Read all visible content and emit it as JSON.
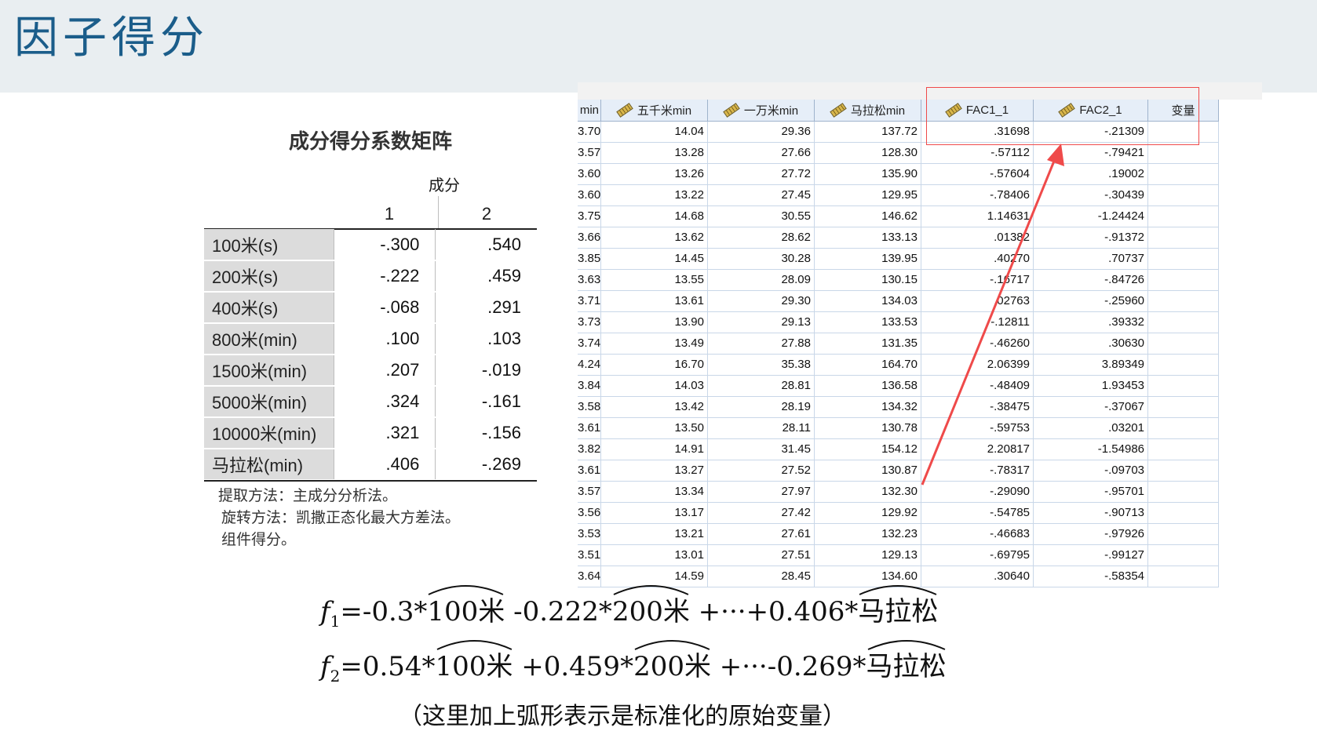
{
  "header": {
    "title": "因子得分"
  },
  "component_score": {
    "title": "成分得分系数矩阵",
    "group_label": "成分",
    "columns": [
      "1",
      "2"
    ],
    "rows": [
      {
        "label": "100米(s)",
        "c1": "-.300",
        "c2": ".540"
      },
      {
        "label": "200米(s)",
        "c1": "-.222",
        "c2": ".459"
      },
      {
        "label": "400米(s)",
        "c1": "-.068",
        "c2": ".291"
      },
      {
        "label": "800米(min)",
        "c1": ".100",
        "c2": ".103"
      },
      {
        "label": "1500米(min)",
        "c1": ".207",
        "c2": "-.019"
      },
      {
        "label": "5000米(min)",
        "c1": ".324",
        "c2": "-.161"
      },
      {
        "label": "10000米(min)",
        "c1": ".321",
        "c2": "-.156"
      },
      {
        "label": "马拉松(min)",
        "c1": ".406",
        "c2": "-.269"
      }
    ],
    "notes": [
      "提取方法：主成分分析法。",
      "旋转方法：凯撒正态化最大方差法。",
      "组件得分。"
    ]
  },
  "grid": {
    "headers": [
      "min",
      "五千米min",
      "一万米min",
      "马拉松min",
      "FAC1_1",
      "FAC2_1",
      "变量"
    ],
    "rows": [
      [
        "3.70",
        "14.04",
        "29.36",
        "137.72",
        ".31698",
        "-.21309"
      ],
      [
        "3.57",
        "13.28",
        "27.66",
        "128.30",
        "-.57112",
        "-.79421"
      ],
      [
        "3.60",
        "13.26",
        "27.72",
        "135.90",
        "-.57604",
        ".19002"
      ],
      [
        "3.60",
        "13.22",
        "27.45",
        "129.95",
        "-.78406",
        "-.30439"
      ],
      [
        "3.75",
        "14.68",
        "30.55",
        "146.62",
        "1.14631",
        "-1.24424"
      ],
      [
        "3.66",
        "13.62",
        "28.62",
        "133.13",
        ".01382",
        "-.91372"
      ],
      [
        "3.85",
        "14.45",
        "30.28",
        "139.95",
        ".40270",
        ".70737"
      ],
      [
        "3.63",
        "13.55",
        "28.09",
        "130.15",
        "-.16717",
        "-.84726"
      ],
      [
        "3.71",
        "13.61",
        "29.30",
        "134.03",
        ".02763",
        "-.25960"
      ],
      [
        "3.73",
        "13.90",
        "29.13",
        "133.53",
        "-.12811",
        ".39332"
      ],
      [
        "3.74",
        "13.49",
        "27.88",
        "131.35",
        "-.46260",
        ".30630"
      ],
      [
        "4.24",
        "16.70",
        "35.38",
        "164.70",
        "2.06399",
        "3.89349"
      ],
      [
        "3.84",
        "14.03",
        "28.81",
        "136.58",
        "-.48409",
        "1.93453"
      ],
      [
        "3.58",
        "13.42",
        "28.19",
        "134.32",
        "-.38475",
        "-.37067"
      ],
      [
        "3.61",
        "13.50",
        "28.11",
        "130.78",
        "-.59753",
        ".03201"
      ],
      [
        "3.82",
        "14.91",
        "31.45",
        "154.12",
        "2.20817",
        "-1.54986"
      ],
      [
        "3.61",
        "13.27",
        "27.52",
        "130.87",
        "-.78317",
        "-.09703"
      ],
      [
        "3.57",
        "13.34",
        "27.97",
        "132.30",
        "-.29090",
        "-.95701"
      ],
      [
        "3.56",
        "13.17",
        "27.42",
        "129.92",
        "-.54785",
        "-.90713"
      ],
      [
        "3.53",
        "13.21",
        "27.61",
        "132.23",
        "-.46683",
        "-.97926"
      ],
      [
        "3.51",
        "13.01",
        "27.51",
        "129.13",
        "-.69795",
        "-.99127"
      ],
      [
        "3.64",
        "14.59",
        "28.45",
        "134.60",
        ".30640",
        "-.58354"
      ]
    ]
  },
  "formula1": {
    "lead": "f",
    "sub": "1",
    "eq": "=",
    "part1": "-0.3*",
    "arc1": "100米",
    "part2": " -0.222*",
    "arc2": "200米",
    "part3": " +···+0.406*",
    "arc3": "马拉松"
  },
  "formula2": {
    "lead": "f",
    "sub": "2",
    "eq": "=",
    "part1": "0.54*",
    "arc1": "100米",
    "part2": " +0.459*",
    "arc2": "200米",
    "part3": " +···-0.269*",
    "arc3": "马拉松"
  },
  "note": "（这里加上弧形表示是标准化的原始变量）",
  "colors": {
    "title": "#1b5d8a",
    "header_bg": "#e9eef1",
    "highlight": "#ef4a4a"
  }
}
